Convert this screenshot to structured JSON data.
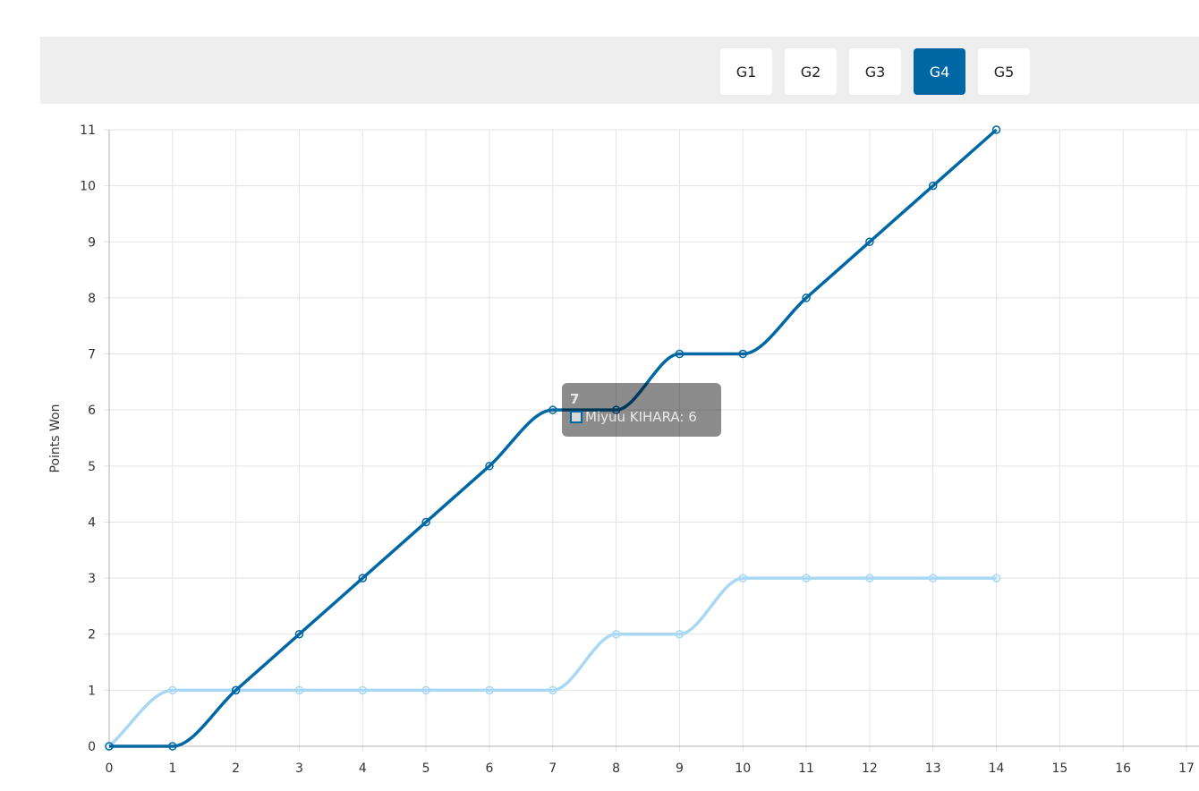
{
  "games": {
    "tabs": [
      {
        "label": "G1",
        "active": false
      },
      {
        "label": "G2",
        "active": false
      },
      {
        "label": "G3",
        "active": false
      },
      {
        "label": "G4",
        "active": true
      },
      {
        "label": "G5",
        "active": false
      }
    ]
  },
  "tooltip": {
    "title": "7",
    "text": "Miyuu KIHARA: 6"
  },
  "chart_data": {
    "type": "line",
    "ylabel": "Points Won",
    "xlabel": "",
    "xlim": [
      0,
      17
    ],
    "ylim": [
      0,
      11
    ],
    "x_ticks": [
      0,
      1,
      2,
      3,
      4,
      5,
      6,
      7,
      8,
      9,
      10,
      11,
      12,
      13,
      14,
      15,
      16,
      17
    ],
    "y_ticks": [
      0,
      1,
      2,
      3,
      4,
      5,
      6,
      7,
      8,
      9,
      10,
      11
    ],
    "grid": true,
    "x": [
      0,
      1,
      2,
      3,
      4,
      5,
      6,
      7,
      8,
      9,
      10,
      11,
      12,
      13,
      14
    ],
    "series": [
      {
        "name": "Miyuu KIHARA",
        "color": "#0067a5",
        "values": [
          0,
          0,
          1,
          2,
          3,
          4,
          5,
          6,
          6,
          7,
          7,
          8,
          9,
          10,
          11
        ]
      },
      {
        "color": "#a8d8f4",
        "values": [
          0,
          1,
          1,
          1,
          1,
          1,
          1,
          1,
          2,
          2,
          3,
          3,
          3,
          3,
          3
        ]
      }
    ]
  }
}
